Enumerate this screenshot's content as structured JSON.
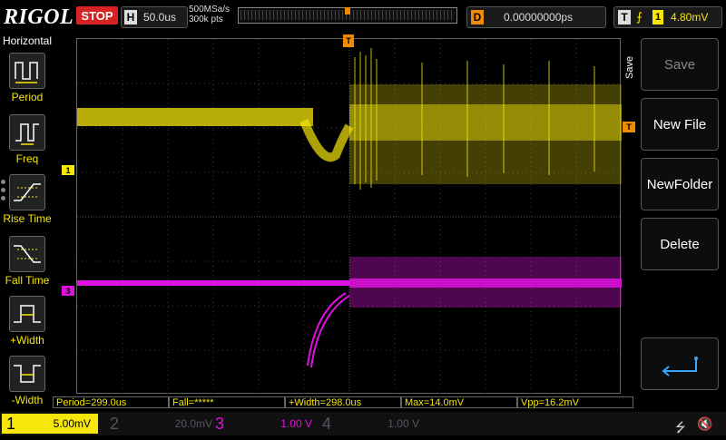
{
  "header": {
    "logo": "RIGOL",
    "run_state": "STOP",
    "horizontal": {
      "label": "H",
      "value": "50.0us"
    },
    "sample_rate": "500MSa/s",
    "memory_depth": "300k pts",
    "delay": {
      "label": "D",
      "value": "0.00000000ps"
    },
    "trigger": {
      "label": "T",
      "edge_symbol": "⨍",
      "source": "1",
      "level": "4.80mV"
    }
  },
  "left_panel": {
    "title": "Horizontal",
    "items": [
      {
        "label": "Period",
        "icon": "period-icon"
      },
      {
        "label": "Freq",
        "icon": "freq-icon"
      },
      {
        "label": "Rise Time",
        "icon": "rise-time-icon"
      },
      {
        "label": "Fall Time",
        "icon": "fall-time-icon"
      },
      {
        "label": "+Width",
        "icon": "pos-width-icon"
      },
      {
        "label": "-Width",
        "icon": "neg-width-icon"
      }
    ]
  },
  "markers": {
    "ch1": "1",
    "ch3": "3",
    "trigger_level": "T",
    "trigger_pos": "T"
  },
  "right_panel": {
    "menu_title": "Save",
    "buttons": [
      {
        "label": "Save",
        "enabled": false
      },
      {
        "label": "New File",
        "enabled": true
      },
      {
        "label": "NewFolder",
        "enabled": true
      },
      {
        "label": "Delete",
        "enabled": true
      }
    ],
    "return_icon": "return-arrow-icon"
  },
  "measurements": [
    {
      "text": "Period=299.0us"
    },
    {
      "text": "Fall=*****"
    },
    {
      "text": "+Width=298.0us"
    },
    {
      "text": "Max=14.0mV"
    },
    {
      "text": "Vpp=16.2mV"
    }
  ],
  "channels": [
    {
      "num": "1",
      "scale": "5.00mV",
      "active": true,
      "color": "#f6e60b"
    },
    {
      "num": "2",
      "scale": "20.0mV",
      "active": false,
      "color": "#2aa6a6"
    },
    {
      "num": "3",
      "scale": "1.00 V",
      "active": true,
      "color": "#e010e0"
    },
    {
      "num": "4",
      "scale": "1.00 V",
      "active": false,
      "color": "#3a6ad0"
    }
  ],
  "colors": {
    "ch1": "#f6e60b",
    "ch3": "#e010e0",
    "trigger": "#f08a00",
    "stop": "#d62222"
  }
}
